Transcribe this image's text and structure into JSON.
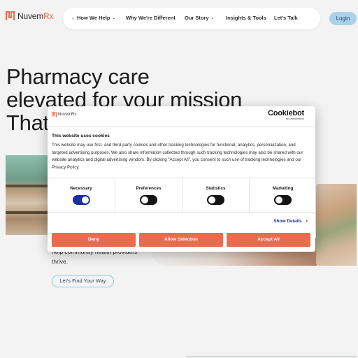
{
  "brand": {
    "name_main": "Nuvem",
    "name_accent": "Rx",
    "accent_color": "#e76a4a"
  },
  "nav": {
    "items": [
      {
        "label": "How We Help",
        "has_dropdown": true
      },
      {
        "label": "Why We're Different",
        "has_dropdown": false
      },
      {
        "label": "Our Story",
        "has_dropdown": true
      },
      {
        "label": "Insights & Tools",
        "has_dropdown": false
      },
      {
        "label": "Let's Talk",
        "has_dropdown": false
      }
    ],
    "dropdown_icon": "chevron-down-icon",
    "login_label": "Login"
  },
  "hero": {
    "title_line1": "Pharmacy care",
    "title_line2": "elevated for your mission",
    "title_line3": "That",
    "body_visible": "help community health providers thrive.",
    "cta_label": "Let's Find Your Way"
  },
  "cookie_dialog": {
    "logo_text": "NuvemRx",
    "provider_name": "Cookiebot",
    "provider_sub": "by Usercentrics",
    "title": "This website uses cookies",
    "text": "This website may use first- and third-party cookies and other tracking technologies for functional, analytics, personalization, and targeted advertising purposes. We also share information collected through such tracking technologies may also be shared with our website analytics and digital advertising vendors. By clicking “Accept All”, you consent to such use of tracking technologies and our Privacy Policy.",
    "categories": [
      {
        "label": "Necessary",
        "enabled": true
      },
      {
        "label": "Preferences",
        "enabled": false
      },
      {
        "label": "Statistics",
        "enabled": false
      },
      {
        "label": "Marketing",
        "enabled": false
      }
    ],
    "show_details_label": "Show Details",
    "buttons": {
      "deny": "Deny",
      "allow_selection": "Allow Selection",
      "accept_all": "Accept All"
    },
    "button_color": "#e76d4e",
    "toggle_on_color": "#1a2fa3"
  }
}
